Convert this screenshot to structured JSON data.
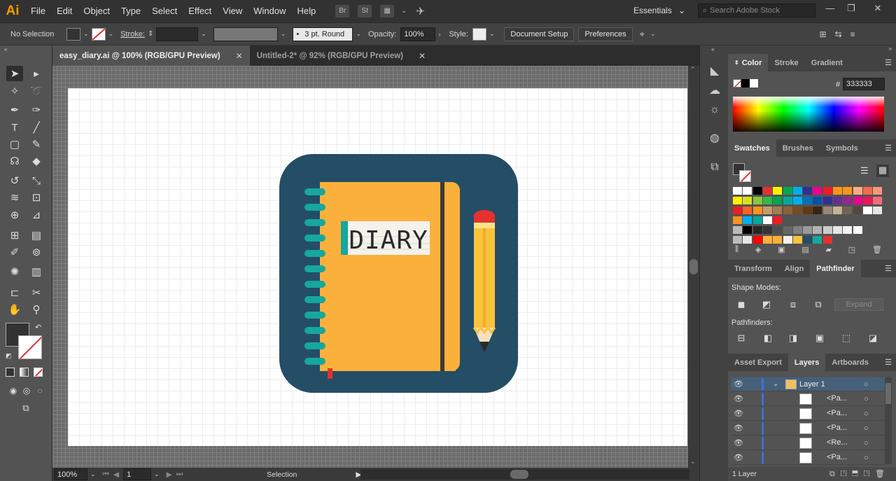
{
  "app": {
    "logo": "Ai",
    "menus": [
      "File",
      "Edit",
      "Object",
      "Type",
      "Select",
      "Effect",
      "View",
      "Window",
      "Help"
    ],
    "bridge_icons": [
      "Br",
      "St"
    ],
    "workspace": "Essentials",
    "search_placeholder": "Search Adobe Stock"
  },
  "control_bar": {
    "selection": "No Selection",
    "stroke_label": "Stroke:",
    "brush": "3 pt. Round",
    "opacity_label": "Opacity:",
    "opacity": "100%",
    "style_label": "Style:",
    "document_setup": "Document Setup",
    "preferences": "Preferences"
  },
  "tabs": [
    {
      "label": "easy_diary.ai @ 100% (RGB/GPU Preview)",
      "active": true
    },
    {
      "label": "Untitled-2* @ 92% (RGB/GPU Preview)",
      "active": false
    }
  ],
  "status": {
    "zoom": "100%",
    "artboard": "1",
    "tool": "Selection"
  },
  "artwork": {
    "notebook_text": "DIARY",
    "colors": {
      "background": "#244d66",
      "cover": "#fbb03b",
      "ring": "#17a79d",
      "pencil": "#f9c33c",
      "eraser": "#e5312e"
    }
  },
  "color_panel": {
    "tabs": [
      "Color",
      "Stroke",
      "Gradient"
    ],
    "hex_label": "#",
    "hex": "333333"
  },
  "swatches_panel": {
    "tabs": [
      "Swatches",
      "Brushes",
      "Symbols"
    ]
  },
  "pathfinder_panel": {
    "tabs": [
      "Transform",
      "Align",
      "Pathfinder"
    ],
    "shape_modes": "Shape Modes:",
    "pathfinders": "Pathfinders:",
    "expand": "Expand"
  },
  "layers_panel": {
    "tabs": [
      "Asset Export",
      "Layers",
      "Artboards"
    ],
    "layer_name": "Layer 1",
    "items": [
      "<Pa...",
      "<Pa...",
      "<Pa...",
      "<Re...",
      "<Pa..."
    ],
    "count": "1 Layer"
  }
}
